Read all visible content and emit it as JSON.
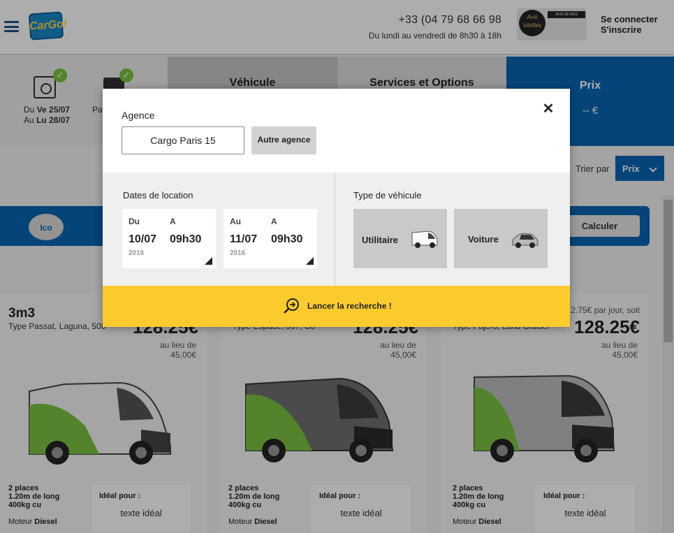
{
  "header": {
    "logo_text": "CarGo!",
    "phone": "+33 (04 79 68 66 98",
    "hours": "Du lundi au vendredi de 8h30 à 18h",
    "badge": {
      "seal_text": "Avis Vérifiés",
      "strip_text": "AVIS DE NOS CLIENTS"
    },
    "login": "Se connecter",
    "register": "S'inscrire"
  },
  "steps": {
    "dates": {
      "from_prefix": "Du ",
      "from_day": "Ve 25/07",
      "to_prefix": "Au ",
      "to_day": "Lu 28/07"
    },
    "second_partial": "Pa",
    "vehicle": "Véhicule",
    "services": "Services et Options",
    "price_title": "Prix",
    "price_value": "-- €"
  },
  "sort": {
    "label": "Trier par",
    "value": "Prix"
  },
  "calc_bar": {
    "ico": "Ico",
    "calc_button": "Calculer"
  },
  "cards": [
    {
      "name": "3m3",
      "type": "Type Passat, Laguna, 508",
      "per_day": "",
      "price": "128.25€",
      "instead_label": "au lieu de",
      "instead_value": "45,00€",
      "specs": [
        "2 places",
        "1.20m de long",
        "400kg cu"
      ],
      "engine_label": "Moteur ",
      "engine_value": "Diesel",
      "ideal_title": "Idéal pour :",
      "ideal_value": "texte idéal"
    },
    {
      "name": "",
      "type": "Type Espace, 807, C8",
      "per_day": "",
      "price": "128.25€",
      "instead_label": "au lieu de",
      "instead_value": "45,00€",
      "specs": [
        "2 places",
        "1.20m de long",
        "400kg cu"
      ],
      "engine_label": "Moteur ",
      "engine_value": "Diesel",
      "ideal_title": "Idéal pour :",
      "ideal_value": "texte idéal"
    },
    {
      "name": "",
      "type": "Type Pajero, Land Cruiser",
      "per_day": "2.75€ par jour, soit",
      "price": "128.25€",
      "instead_label": "au lieu de",
      "instead_value": "45,00€",
      "specs": [
        "2 places",
        "1.20m de long",
        "400kg cu"
      ],
      "engine_label": "Moteur ",
      "engine_value": "Diesel",
      "ideal_title": "Idéal pour :",
      "ideal_value": "texte idéal"
    }
  ],
  "modal": {
    "agence_label": "Agence",
    "agence_value": "Cargo Paris 15",
    "autre_agence": "Autre agence",
    "dates_label": "Dates de location",
    "type_label": "Type de véhicule",
    "start": {
      "k1": "Du",
      "k2": "A",
      "date": "10/07",
      "time": "09h30",
      "year": "2016"
    },
    "end": {
      "k1": "Au",
      "k2": "A",
      "date": "11/07",
      "time": "09h30",
      "year": "2016"
    },
    "types": [
      "Utilitaire",
      "Voiture"
    ],
    "search_button": "Lancer la recherche !"
  },
  "colors": {
    "brand_blue": "#0765b3",
    "accent_yellow": "#fecb2f",
    "check_green": "#7bc242"
  }
}
